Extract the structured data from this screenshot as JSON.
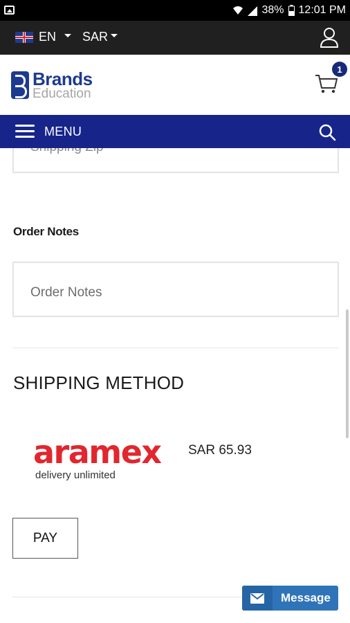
{
  "status_bar": {
    "battery": "38%",
    "time": "12:01 PM"
  },
  "topbar": {
    "language": "EN",
    "currency": "SAR"
  },
  "header": {
    "logo_primary": "Brands",
    "logo_secondary": "Education",
    "cart_count": "1"
  },
  "menubar": {
    "menu_label": "MENU"
  },
  "form": {
    "shipping_zip_placeholder": "Shipping Zip",
    "order_notes_label": "Order Notes",
    "order_notes_placeholder": "Order Notes"
  },
  "shipping": {
    "title": "SHIPPING METHOD",
    "carrier_name": "aramex",
    "carrier_tagline": "delivery unlimited",
    "price": "SAR 65.93"
  },
  "actions": {
    "pay_label": "PAY",
    "message_label": "Message"
  },
  "colors": {
    "topbar": "#202020",
    "menubar": "#17258a",
    "brand": "#1c3a8f",
    "aramex_red": "#e2262e",
    "message_button": "#2f74b8"
  }
}
